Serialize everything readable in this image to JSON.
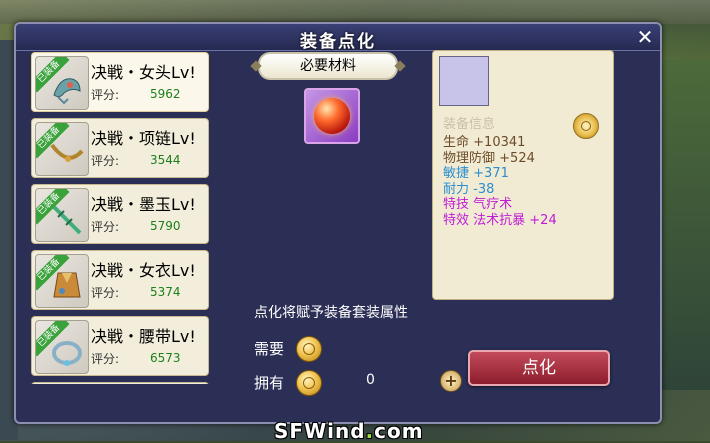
{
  "dialog": {
    "title": "装备点化",
    "close_label": "✕"
  },
  "items": [
    {
      "name": "决戦・女头Lv!",
      "score_label": "评分:",
      "score": "5962",
      "tag": "已装备",
      "icon": "headgear-icon",
      "selected": true
    },
    {
      "name": "决戦・项链Lv!",
      "score_label": "评分:",
      "score": "3544",
      "tag": "已装备",
      "icon": "necklace-icon",
      "selected": false
    },
    {
      "name": "决戦・墨玉Lv!",
      "score_label": "评分:",
      "score": "5790",
      "tag": "已装备",
      "icon": "jade-sword-icon",
      "selected": false
    },
    {
      "name": "决戦・女衣Lv!",
      "score_label": "评分:",
      "score": "5374",
      "tag": "已装备",
      "icon": "robe-icon",
      "selected": false
    },
    {
      "name": "决戦・腰带Lv!",
      "score_label": "评分:",
      "score": "6573",
      "tag": "已装备",
      "icon": "belt-icon",
      "selected": false
    }
  ],
  "material": {
    "banner": "必要材料",
    "icon": "fire-orb-icon"
  },
  "info": {
    "header": "装备信息",
    "stats": [
      {
        "label": "生命",
        "value": "+10341",
        "color": "#6b4b2a"
      },
      {
        "label": "物理防御",
        "value": "+524",
        "color": "#6b4b2a"
      },
      {
        "label": "敏捷",
        "value": "+371",
        "color": "#2a8ed0"
      },
      {
        "label": "耐力",
        "value": "-38",
        "color": "#2a8ed0"
      },
      {
        "label": "特技",
        "value": "气疗术",
        "color": "#c11ad6"
      },
      {
        "label": "特效",
        "value": "法术抗暴 +24",
        "color": "#c11ad6"
      }
    ]
  },
  "bottom": {
    "description": "点化将赋予装备套装属性",
    "need_label": "需要",
    "own_label": "拥有",
    "own_value": "0",
    "plus_label": "+",
    "action_label": "点化"
  },
  "watermark": {
    "part1": "SFWind",
    "dot": ".",
    "part2": "com"
  }
}
